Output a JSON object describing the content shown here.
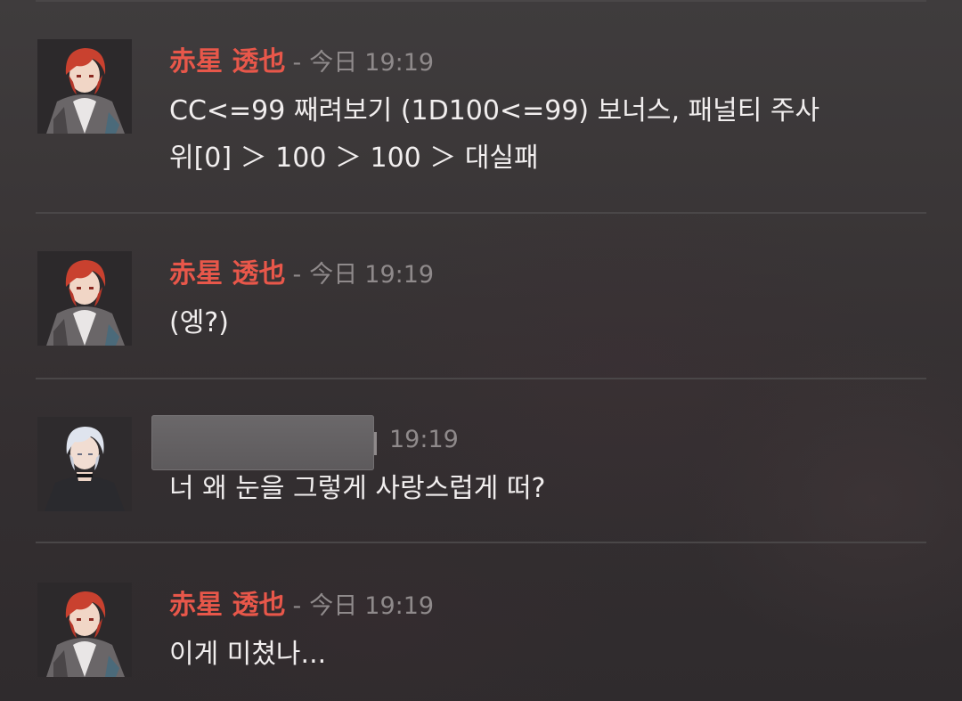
{
  "messages": [
    {
      "author": "赤星 透也",
      "separator": "-",
      "date": "今日",
      "time": "19:19",
      "lines": [
        "CC<=99 째려보기 (1D100<=99) 보너스, 패널티 주사",
        "위[0] ＞ 100 ＞ 100 ＞ 대실패"
      ]
    },
    {
      "author": "赤星 透也",
      "separator": "-",
      "date": "今日",
      "time": "19:19",
      "lines": [
        "(엥?)"
      ]
    },
    {
      "author_redacted": true,
      "time": "19:19",
      "lines": [
        "너 왜 눈을 그렇게 사랑스럽게 떠?"
      ]
    },
    {
      "author": "赤星 透也",
      "separator": "-",
      "date": "今日",
      "time": "19:19",
      "lines": [
        "이게 미쳤나..."
      ]
    }
  ],
  "colors": {
    "author": "#e8574a",
    "timestamp": "#8f8a8b",
    "text": "#f1eeee",
    "divider": "#4a4748"
  },
  "avatars": [
    "red-haired-character-avatar",
    "red-haired-character-avatar",
    "white-haired-character-avatar",
    "red-haired-character-avatar"
  ]
}
